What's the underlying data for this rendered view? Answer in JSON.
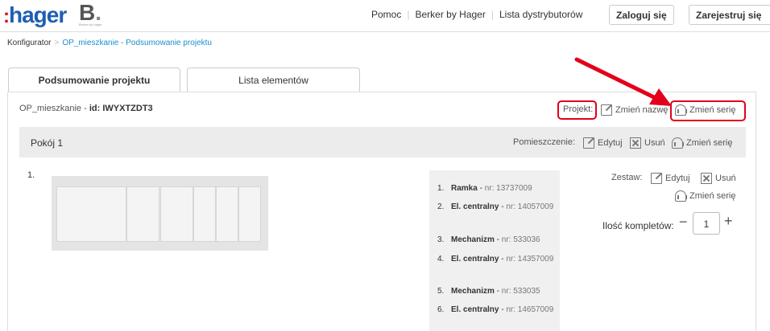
{
  "header": {
    "logo_hager": "hager",
    "logo_berker": "B",
    "logo_berker_sub": "Berker by hager",
    "nav": [
      "Pomoc",
      "Berker by Hager",
      "Lista dystrybutorów"
    ],
    "login_label": "Zaloguj się",
    "register_label": "Zarejestruj się"
  },
  "breadcrumb": {
    "root": "Konfigurator",
    "current": "OP_mieszkanie - Podsumowanie projektu"
  },
  "tabs": [
    {
      "label": "Podsumowanie projektu",
      "active": true
    },
    {
      "label": "Lista elementów",
      "active": false
    }
  ],
  "project": {
    "name": "OP_mieszkanie",
    "id_label": "id:",
    "id": "IWYXTZDT3",
    "section_label": "Projekt:",
    "rename_label": "Zmień nazwę",
    "change_series_label": "Zmień serię"
  },
  "room": {
    "name": "Pokój 1",
    "section_label": "Pomieszczenie:",
    "edit_label": "Edytuj",
    "delete_label": "Usuń",
    "change_series_label": "Zmień serię"
  },
  "set": {
    "number": "1.",
    "section_label": "Zestaw:",
    "edit_label": "Edytuj",
    "delete_label": "Usuń",
    "change_series_label": "Zmień serię",
    "qty_label": "Ilość kompletów:",
    "qty_value": "1",
    "qty_minus": "−",
    "qty_plus": "+",
    "parts": [
      {
        "num": "1.",
        "name": "Ramka",
        "nr": "nr: 13737009"
      },
      {
        "num": "2.",
        "name": "El. centralny",
        "nr": "nr: 14057009"
      },
      {
        "num": "3.",
        "name": "Mechanizm",
        "nr": "nr: 533036"
      },
      {
        "num": "4.",
        "name": "El. centralny",
        "nr": "nr: 14357009"
      },
      {
        "num": "5.",
        "name": "Mechanizm",
        "nr": "nr: 533035"
      },
      {
        "num": "6.",
        "name": "El. centralny",
        "nr": "nr: 14657009"
      }
    ]
  },
  "colors": {
    "accent_red": "#e2001a",
    "link_blue": "#1a8ed0",
    "hager_blue": "#1e5fb3"
  }
}
